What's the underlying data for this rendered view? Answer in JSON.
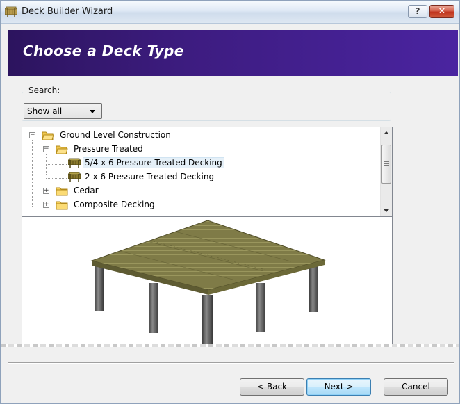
{
  "window": {
    "title": "Deck Builder Wizard"
  },
  "title_buttons": {
    "help_label": "?",
    "close_label": "✕"
  },
  "header": {
    "title": "Choose a Deck Type"
  },
  "search": {
    "label": "Search:",
    "selected": "Show all"
  },
  "tree": {
    "items": [
      {
        "label": "Ground Level Construction",
        "expanded": true,
        "icon": "folder-open-icon"
      },
      {
        "label": "Pressure Treated",
        "expanded": true,
        "icon": "folder-open-icon"
      },
      {
        "label": "5/4 x 6 Pressure Treated Decking",
        "icon": "deck-icon",
        "selected": true
      },
      {
        "label": "2 x 6 Pressure Treated Decking",
        "icon": "deck-icon"
      },
      {
        "label": "Cedar",
        "expanded": false,
        "icon": "folder-icon"
      },
      {
        "label": "Composite Decking",
        "expanded": false,
        "icon": "folder-icon"
      }
    ]
  },
  "buttons": {
    "back": "< Back",
    "next": "Next >",
    "cancel": "Cancel"
  },
  "colors": {
    "header_bg": "#3d1c80",
    "deck_surface": "#7d7a45",
    "post": "#5a5a5a"
  }
}
